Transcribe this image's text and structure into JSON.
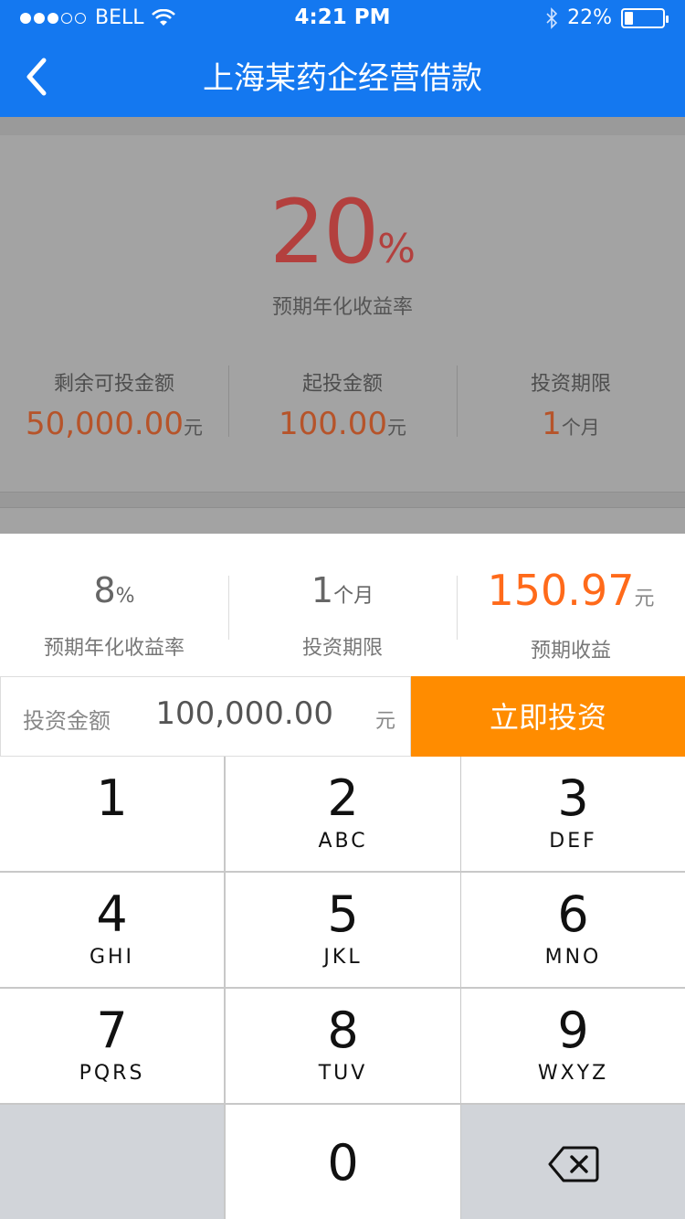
{
  "status_bar": {
    "carrier": "BELL",
    "time": "4:21 PM",
    "battery": "22%",
    "battery_level": 0.22
  },
  "nav": {
    "title": "上海某药企经营借款"
  },
  "product": {
    "rate_value": "20",
    "rate_unit": "%",
    "rate_label": "预期年化收益率",
    "stats": [
      {
        "label": "剩余可投金额",
        "value": "50,000.00",
        "unit": "元"
      },
      {
        "label": "起投金额",
        "value": "100.00",
        "unit": "元"
      },
      {
        "label": "投资期限",
        "value": "1",
        "unit": "个月"
      }
    ]
  },
  "summary": [
    {
      "value": "8",
      "unit": "%",
      "label": "预期年化收益率"
    },
    {
      "value": "1",
      "unit": "个月",
      "label": "投资期限"
    },
    {
      "value": "150.97",
      "unit": "元",
      "label": "预期收益"
    }
  ],
  "invest": {
    "input_label": "投资金额",
    "amount": "100,000.00",
    "unit": "元",
    "button_label": "立即投资"
  },
  "keypad": {
    "keys": [
      {
        "digit": "1",
        "letters": ""
      },
      {
        "digit": "2",
        "letters": "ABC"
      },
      {
        "digit": "3",
        "letters": "DEF"
      },
      {
        "digit": "4",
        "letters": "GHI"
      },
      {
        "digit": "5",
        "letters": "JKL"
      },
      {
        "digit": "6",
        "letters": "MNO"
      },
      {
        "digit": "7",
        "letters": "PQRS"
      },
      {
        "digit": "8",
        "letters": "TUV"
      },
      {
        "digit": "9",
        "letters": "WXYZ"
      },
      {
        "digit": "0",
        "letters": ""
      }
    ],
    "delete_icon": "backspace-icon"
  },
  "colors": {
    "nav": "#1478f0",
    "accent_orange": "#ff8c00",
    "rate_red": "#b3403e",
    "earn_orange": "#ff6a1a"
  }
}
